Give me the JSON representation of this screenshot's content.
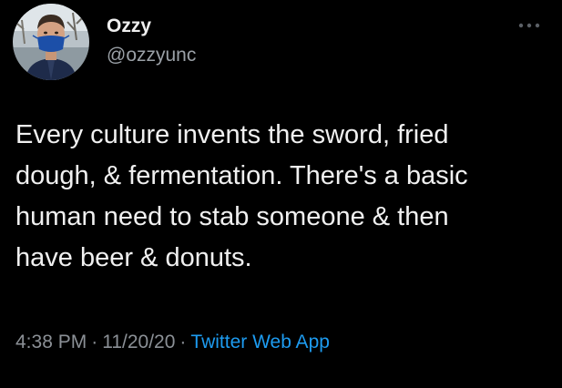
{
  "tweet": {
    "author": {
      "display_name": "Ozzy",
      "handle": "@ozzyunc",
      "avatar_icon": "profile-photo"
    },
    "more_icon": "ellipsis-icon",
    "text_lines": [
      "Every culture invents the sword, fried",
      "dough, & fermentation. There's a basic",
      "human need to stab someone & then",
      "have beer & donuts."
    ],
    "meta": {
      "time": "4:38 PM",
      "separator": "·",
      "date": "11/20/20",
      "source": "Twitter Web App"
    }
  },
  "colors": {
    "background": "#000000",
    "text": "#f0f0f0",
    "secondary_text": "#8b9096",
    "link": "#1d9bf0"
  }
}
